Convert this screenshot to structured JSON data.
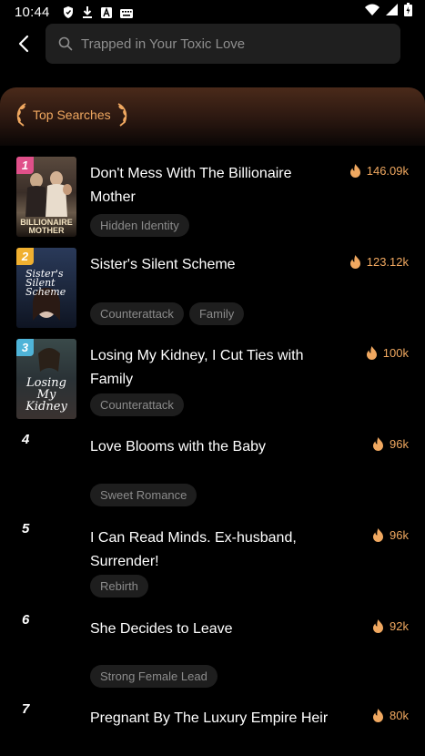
{
  "status_bar": {
    "time": "10:44",
    "left_icons": [
      "shield-icon",
      "download-icon",
      "font-icon",
      "keyboard-icon"
    ],
    "right_icons": [
      "wifi-icon",
      "signal-icon",
      "battery-icon"
    ]
  },
  "search": {
    "placeholder": "Trapped in Your Toxic Love"
  },
  "top_searches": {
    "label": "Top Searches"
  },
  "items": [
    {
      "rank": "1",
      "title": "Don't Mess With The Billionaire Mother",
      "heat": "146.09k",
      "tags": [
        "Hidden Identity"
      ],
      "cover_text": "BILLIONAIRE MOTHER",
      "badge_color": "#e0508a"
    },
    {
      "rank": "2",
      "title": "Sister's Silent Scheme",
      "heat": "123.12k",
      "tags": [
        "Counterattack",
        "Family"
      ],
      "cover_text": "Sister's Silent Scheme",
      "badge_color": "#f0b030"
    },
    {
      "rank": "3",
      "title": "Losing My Kidney, I Cut Ties with Family",
      "heat": "100k",
      "tags": [
        "Counterattack"
      ],
      "cover_text": "Losing My Kidney",
      "badge_color": "#4fb4d8"
    },
    {
      "rank": "4",
      "title": "Love Blooms with the Baby",
      "heat": "96k",
      "tags": [
        "Sweet Romance"
      ]
    },
    {
      "rank": "5",
      "title": "I Can Read Minds. Ex-husband, Surrender!",
      "heat": "96k",
      "tags": [
        "Rebirth"
      ]
    },
    {
      "rank": "6",
      "title": "She Decides to Leave",
      "heat": "92k",
      "tags": [
        "Strong Female Lead"
      ]
    },
    {
      "rank": "7",
      "title": "Pregnant By The Luxury Empire Heir",
      "heat": "80k",
      "tags": []
    }
  ],
  "colors": {
    "accent": "#f0a860",
    "background": "#000000",
    "tag_bg": "#1e1e1e"
  }
}
